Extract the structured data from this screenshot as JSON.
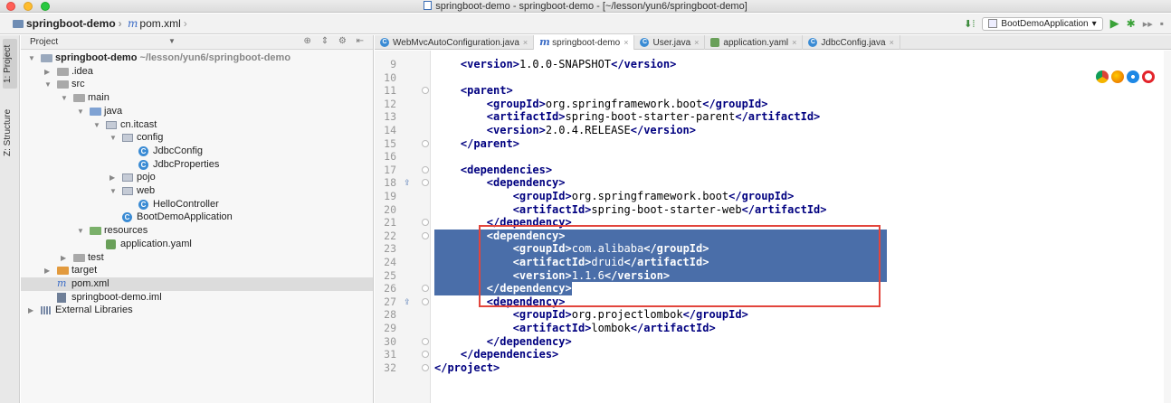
{
  "window": {
    "title": "springboot-demo - springboot-demo - [~/lesson/yun6/springboot-demo]"
  },
  "navbar": {
    "project": "springboot-demo",
    "file": "pom.xml",
    "run_config": "BootDemoApplication"
  },
  "side_tabs": {
    "project": "1: Project",
    "structure": "Z: Structure"
  },
  "project_panel": {
    "header": "Project",
    "tree": [
      {
        "label": "springboot-demo",
        "extra": "~/lesson/yun6/springboot-demo",
        "depth": 0,
        "arrow": "down",
        "icon": "module-folder",
        "bold": true
      },
      {
        "label": ".idea",
        "depth": 1,
        "arrow": "right",
        "icon": "folder"
      },
      {
        "label": "src",
        "depth": 1,
        "arrow": "down",
        "icon": "folder"
      },
      {
        "label": "main",
        "depth": 2,
        "arrow": "down",
        "icon": "folder"
      },
      {
        "label": "java",
        "depth": 3,
        "arrow": "down",
        "icon": "source-folder"
      },
      {
        "label": "cn.itcast",
        "depth": 4,
        "arrow": "down",
        "icon": "package"
      },
      {
        "label": "config",
        "depth": 5,
        "arrow": "down",
        "icon": "package"
      },
      {
        "label": "JdbcConfig",
        "depth": 6,
        "arrow": "none",
        "icon": "class"
      },
      {
        "label": "JdbcProperties",
        "depth": 6,
        "arrow": "none",
        "icon": "class"
      },
      {
        "label": "pojo",
        "depth": 5,
        "arrow": "right",
        "icon": "package"
      },
      {
        "label": "web",
        "depth": 5,
        "arrow": "down",
        "icon": "package"
      },
      {
        "label": "HelloController",
        "depth": 6,
        "arrow": "none",
        "icon": "class"
      },
      {
        "label": "BootDemoApplication",
        "depth": 5,
        "arrow": "none",
        "icon": "spring-class"
      },
      {
        "label": "resources",
        "depth": 3,
        "arrow": "down",
        "icon": "resources-folder"
      },
      {
        "label": "application.yaml",
        "depth": 4,
        "arrow": "none",
        "icon": "yaml"
      },
      {
        "label": "test",
        "depth": 2,
        "arrow": "right",
        "icon": "folder"
      },
      {
        "label": "target",
        "depth": 1,
        "arrow": "right",
        "icon": "excluded-folder"
      },
      {
        "label": "pom.xml",
        "depth": 1,
        "arrow": "none",
        "icon": "maven",
        "selected": true
      },
      {
        "label": "springboot-demo.iml",
        "depth": 1,
        "arrow": "none",
        "icon": "iml"
      },
      {
        "label": "External Libraries",
        "depth": 0,
        "arrow": "right",
        "icon": "library"
      }
    ]
  },
  "tabs": [
    {
      "label": "WebMvcAutoConfiguration.java",
      "icon": "class",
      "active": false
    },
    {
      "label": "springboot-demo",
      "icon": "maven",
      "active": true
    },
    {
      "label": "User.java",
      "icon": "class",
      "active": false
    },
    {
      "label": "application.yaml",
      "icon": "yaml",
      "active": false
    },
    {
      "label": "JdbcConfig.java",
      "icon": "class",
      "active": false
    }
  ],
  "editor": {
    "lines": [
      {
        "n": "9",
        "indent": 4,
        "parts": [
          [
            "tag",
            "<version>"
          ],
          [
            "txt",
            "1.0.0-SNAPSHOT"
          ],
          [
            "tag",
            "</version>"
          ]
        ]
      },
      {
        "n": "10",
        "indent": 0,
        "parts": []
      },
      {
        "n": "11",
        "indent": 4,
        "parts": [
          [
            "tag",
            "<parent>"
          ]
        ]
      },
      {
        "n": "12",
        "indent": 8,
        "parts": [
          [
            "tag",
            "<groupId>"
          ],
          [
            "txt",
            "org.springframework.boot"
          ],
          [
            "tag",
            "</groupId>"
          ]
        ]
      },
      {
        "n": "13",
        "indent": 8,
        "parts": [
          [
            "tag",
            "<artifactId>"
          ],
          [
            "txt",
            "spring-boot-starter-parent"
          ],
          [
            "tag",
            "</artifactId>"
          ]
        ]
      },
      {
        "n": "14",
        "indent": 8,
        "parts": [
          [
            "tag",
            "<version>"
          ],
          [
            "txt",
            "2.0.4.RELEASE"
          ],
          [
            "tag",
            "</version>"
          ]
        ]
      },
      {
        "n": "15",
        "indent": 4,
        "parts": [
          [
            "tag",
            "</parent>"
          ]
        ]
      },
      {
        "n": "16",
        "indent": 0,
        "parts": []
      },
      {
        "n": "17",
        "indent": 4,
        "parts": [
          [
            "tag",
            "<dependencies>"
          ]
        ]
      },
      {
        "n": "18",
        "indent": 8,
        "parts": [
          [
            "tag",
            "<dependency>"
          ]
        ]
      },
      {
        "n": "19",
        "indent": 12,
        "parts": [
          [
            "tag",
            "<groupId>"
          ],
          [
            "txt",
            "org.springframework.boot"
          ],
          [
            "tag",
            "</groupId>"
          ]
        ]
      },
      {
        "n": "20",
        "indent": 12,
        "parts": [
          [
            "tag",
            "<artifactId>"
          ],
          [
            "txt",
            "spring-boot-starter-web"
          ],
          [
            "tag",
            "</artifactId>"
          ]
        ]
      },
      {
        "n": "21",
        "indent": 8,
        "parts": [
          [
            "tag",
            "</dependency>"
          ]
        ]
      },
      {
        "n": "22",
        "indent": 8,
        "parts": [
          [
            "tag",
            "<dependency>"
          ]
        ],
        "selected": true
      },
      {
        "n": "23",
        "indent": 12,
        "parts": [
          [
            "tag",
            "<groupId>"
          ],
          [
            "txt",
            "com.alibaba"
          ],
          [
            "tag",
            "</groupId>"
          ]
        ],
        "selected": true
      },
      {
        "n": "24",
        "indent": 12,
        "parts": [
          [
            "tag",
            "<artifactId>"
          ],
          [
            "txt",
            "druid"
          ],
          [
            "tag",
            "</artifactId>"
          ]
        ],
        "selected": true
      },
      {
        "n": "25",
        "indent": 12,
        "parts": [
          [
            "tag",
            "<version>"
          ],
          [
            "txt",
            "1.1.6"
          ],
          [
            "tag",
            "</version>"
          ]
        ],
        "selected": true
      },
      {
        "n": "26",
        "indent": 8,
        "parts": [
          [
            "tag",
            "</dependency>"
          ]
        ],
        "selected": true
      },
      {
        "n": "27",
        "indent": 8,
        "parts": [
          [
            "tag",
            "<dependency>"
          ]
        ]
      },
      {
        "n": "28",
        "indent": 12,
        "parts": [
          [
            "tag",
            "<groupId>"
          ],
          [
            "txt",
            "org.projectlombok"
          ],
          [
            "tag",
            "</groupId>"
          ]
        ]
      },
      {
        "n": "29",
        "indent": 12,
        "parts": [
          [
            "tag",
            "<artifactId>"
          ],
          [
            "txt",
            "lombok"
          ],
          [
            "tag",
            "</artifactId>"
          ]
        ]
      },
      {
        "n": "30",
        "indent": 8,
        "parts": [
          [
            "tag",
            "</dependency>"
          ]
        ]
      },
      {
        "n": "31",
        "indent": 4,
        "parts": [
          [
            "tag",
            "</dependencies>"
          ]
        ]
      },
      {
        "n": "32",
        "indent": 0,
        "parts": [
          [
            "tag",
            "</project>"
          ]
        ]
      }
    ]
  },
  "colors": {
    "selection": "#4a6ea9",
    "highlight_box": "#e2453c",
    "xml_tag": "#000080"
  }
}
